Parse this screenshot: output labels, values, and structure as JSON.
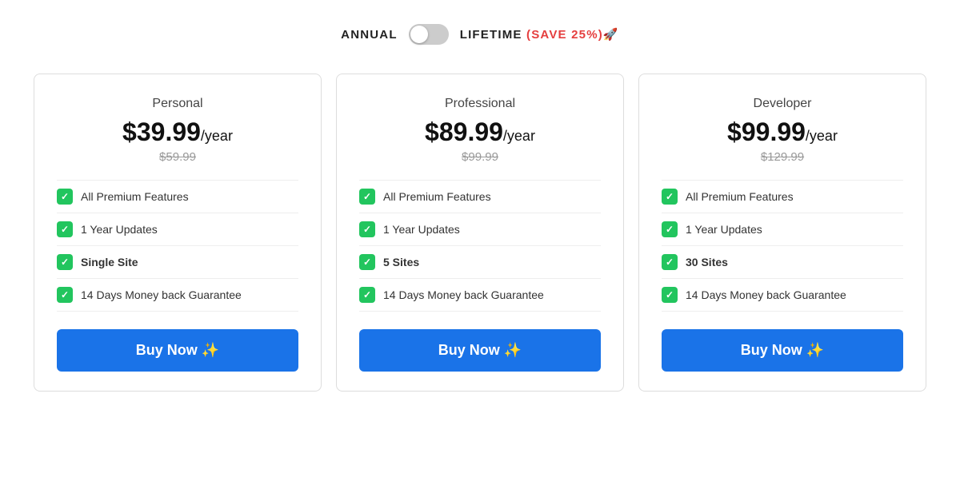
{
  "billing": {
    "annual_label": "ANNUAL",
    "lifetime_label": "LIFETIME",
    "save_badge": "(SAVE 25%)🚀",
    "toggle_state": "annual"
  },
  "plans": [
    {
      "id": "personal",
      "name": "Personal",
      "price": "$39.99",
      "period": "/year",
      "original": "$59.99",
      "features": [
        {
          "text": "All Premium Features",
          "bold": false
        },
        {
          "text": "1 Year Updates",
          "bold": false
        },
        {
          "text": "Single Site",
          "bold": true
        },
        {
          "text": "14 Days Money back Guarantee",
          "bold": false
        }
      ],
      "cta": "Buy Now ✨"
    },
    {
      "id": "professional",
      "name": "Professional",
      "price": "$89.99",
      "period": "/year",
      "original": "$99.99",
      "features": [
        {
          "text": "All Premium Features",
          "bold": false
        },
        {
          "text": "1 Year Updates",
          "bold": false
        },
        {
          "text": "5 Sites",
          "bold": true
        },
        {
          "text": "14 Days Money back Guarantee",
          "bold": false
        }
      ],
      "cta": "Buy Now ✨"
    },
    {
      "id": "developer",
      "name": "Developer",
      "price": "$99.99",
      "period": "/year",
      "original": "$129.99",
      "features": [
        {
          "text": "All Premium Features",
          "bold": false
        },
        {
          "text": "1 Year Updates",
          "bold": false
        },
        {
          "text": "30 Sites",
          "bold": true
        },
        {
          "text": "14 Days Money back Guarantee",
          "bold": false
        }
      ],
      "cta": "Buy Now ✨"
    }
  ]
}
